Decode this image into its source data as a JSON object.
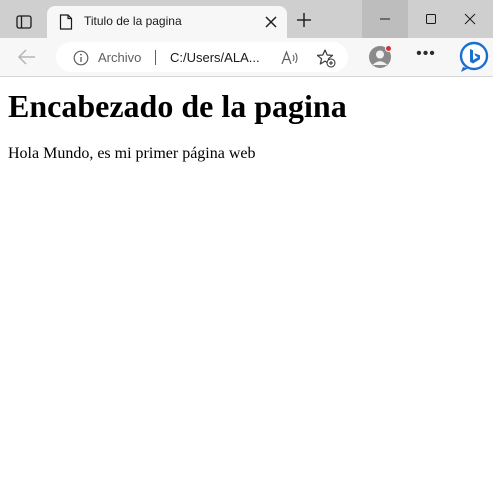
{
  "tab": {
    "title": "Titulo de la pagina"
  },
  "toolbar": {
    "chip_label": "Archivo",
    "url": "C:/Users/ALA..."
  },
  "page": {
    "heading": "Encabezado de la pagina",
    "paragraph": "Hola Mundo, es mi primer página web"
  },
  "colors": {
    "titlebar": "#cfcfcf",
    "toolbar": "#f7f7f7",
    "bing_blue": "#1b6fd1",
    "notification_dot": "#d13438"
  }
}
